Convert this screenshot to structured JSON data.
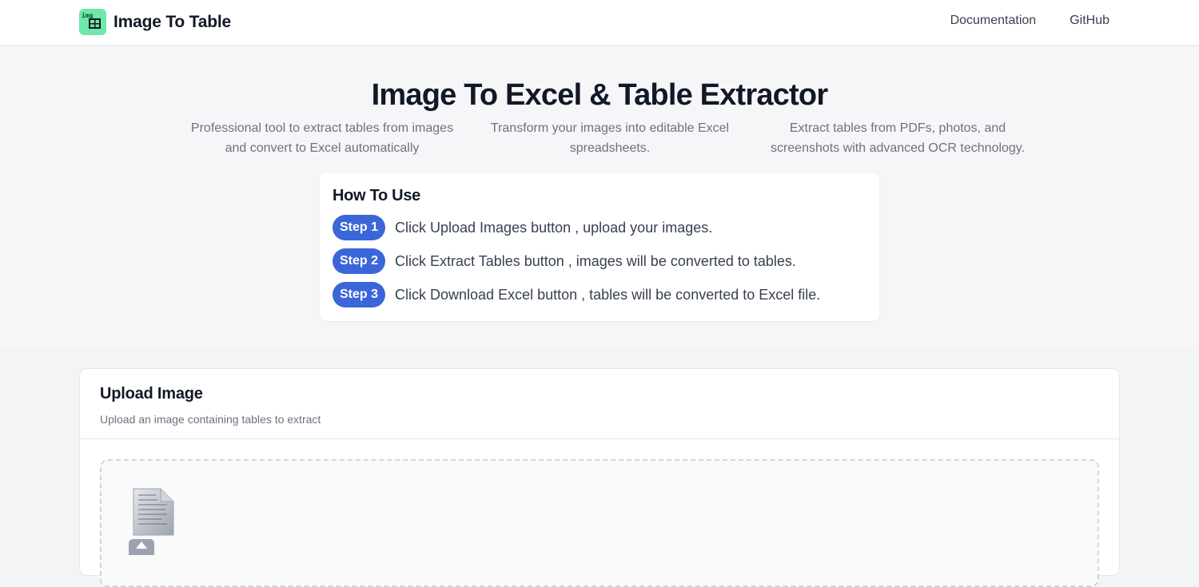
{
  "header": {
    "logo_text": "img",
    "brand": "Image To Table",
    "nav": [
      {
        "label": "Documentation"
      },
      {
        "label": "GitHub"
      }
    ]
  },
  "hero": {
    "title": "Image To Excel & Table Extractor",
    "subtitles": [
      "Professional tool to extract tables from images and convert to Excel automatically",
      "Transform your images into editable Excel spreadsheets.",
      "Extract tables from PDFs, photos, and screenshots with advanced OCR technology."
    ]
  },
  "howto": {
    "title": "How To Use",
    "steps": [
      {
        "badge": "Step 1",
        "text": "Click Upload Images button , upload your images."
      },
      {
        "badge": "Step 2",
        "text": "Click Extract Tables button , images will be converted to tables."
      },
      {
        "badge": "Step 3",
        "text": "Click Download Excel button , tables will be converted to Excel file."
      }
    ]
  },
  "upload": {
    "title": "Upload Image",
    "description": "Upload an image containing tables to extract",
    "icons": [
      "file-icon",
      "upload-arrow-icon"
    ]
  },
  "colors": {
    "accent": "#3b66d8",
    "logo_bg": "#6ee7a8"
  }
}
